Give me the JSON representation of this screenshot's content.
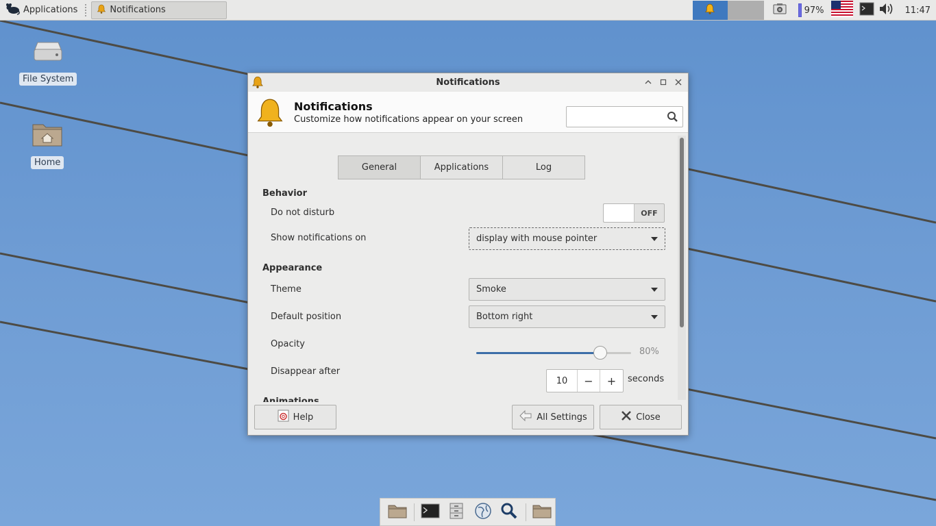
{
  "panel": {
    "apps_label": "Applications",
    "task_label": "Notifications",
    "battery": "97%",
    "clock": "11:47"
  },
  "desktop": {
    "icons": [
      {
        "label": "File System",
        "icon": "drive-icon"
      },
      {
        "label": "Home",
        "icon": "home-folder-icon"
      }
    ]
  },
  "dialog": {
    "window_title": "Notifications",
    "header_title": "Notifications",
    "header_subtitle": "Customize how notifications appear on your screen",
    "search_placeholder": "",
    "tabs": [
      {
        "label": "General",
        "active": true
      },
      {
        "label": "Applications",
        "active": false
      },
      {
        "label": "Log",
        "active": false
      }
    ],
    "behavior": {
      "title": "Behavior",
      "dnd_label": "Do not disturb",
      "dnd_state": "OFF",
      "show_on_label": "Show notifications on",
      "show_on_value": "display with mouse pointer"
    },
    "appearance": {
      "title": "Appearance",
      "theme_label": "Theme",
      "theme_value": "Smoke",
      "position_label": "Default position",
      "position_value": "Bottom right",
      "opacity_label": "Opacity",
      "opacity_value": "80%",
      "opacity_fraction": 0.8,
      "disappear_label": "Disappear after",
      "disappear_value": "10",
      "disappear_unit": "seconds",
      "minus": "−",
      "plus": "+"
    },
    "next_section": "Animations",
    "footer": {
      "help": "Help",
      "all_settings": "All Settings",
      "close": "Close"
    }
  },
  "colors": {
    "accent": "#3c6ea8",
    "tray_active": "#3f79bf"
  }
}
